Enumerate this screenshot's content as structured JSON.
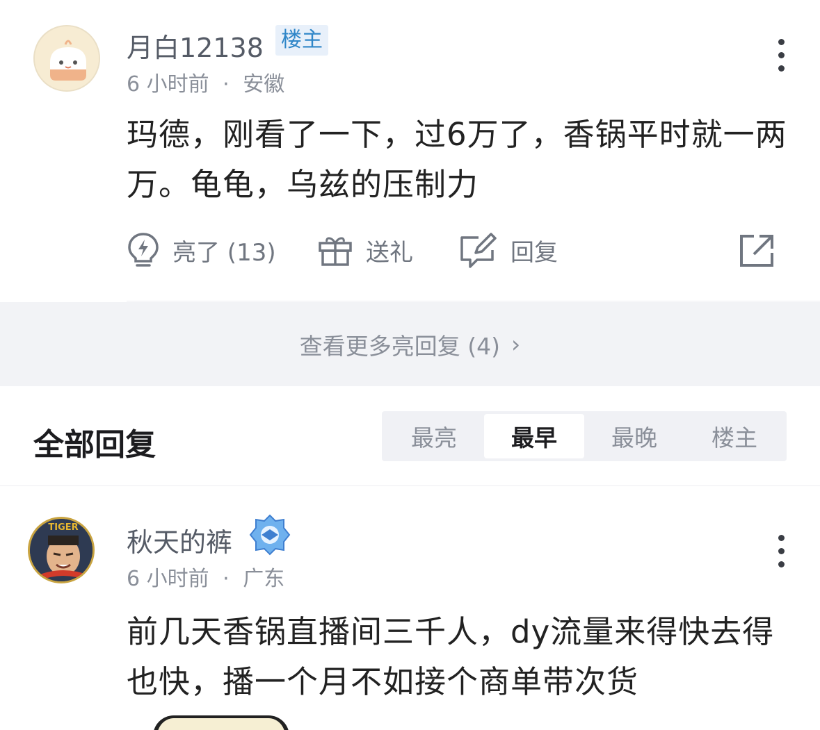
{
  "post1": {
    "username": "月白12138",
    "op_badge": "楼主",
    "time": "6 小时前",
    "separator": "·",
    "location": "安徽",
    "content": "玛德，刚看了一下，过6万了，香锅平时就一两万。龟龟，乌兹的压制力",
    "actions": {
      "like_label": "亮了 (13)",
      "gift_label": "送礼",
      "reply_label": "回复"
    },
    "icons": [
      "avatar-icon",
      "more-icon",
      "lightbulb-icon",
      "gift-icon",
      "reply-edit-icon",
      "share-icon"
    ]
  },
  "more_replies": {
    "label": "查看更多亮回复 (4)",
    "chevron": "›"
  },
  "section": {
    "title": "全部回复",
    "sort_tabs": [
      "最亮",
      "最早",
      "最晚",
      "楼主"
    ],
    "active_tab": "最早"
  },
  "post2": {
    "username": "秋天的裤",
    "time": "6 小时前",
    "separator": "·",
    "location": "广东",
    "content": "前几天香锅直播间三千人，dy流量来得快去得也快，播一个月不如接个商单带次货",
    "avatar_text": "TIGER"
  },
  "colors": {
    "badge_bg": "#e8f0fa",
    "badge_text": "#2f86c8",
    "muted": "#8a8f99",
    "active_tab_bg": "#ffffff",
    "bar_bg": "#f2f3f6"
  }
}
